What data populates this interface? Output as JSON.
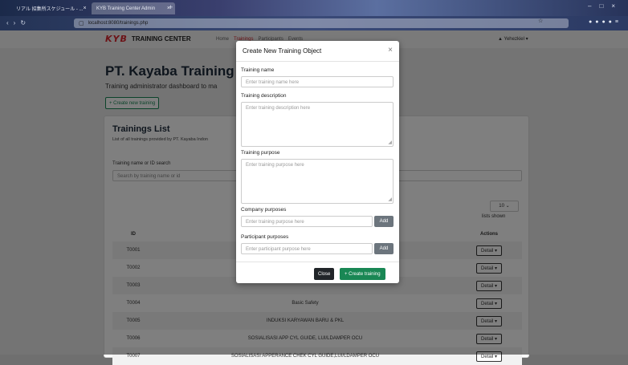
{
  "browser": {
    "tabs": [
      {
        "label": "リアル 招集所スケジュール - ..."
      },
      {
        "label": "KYB Training Center Admin"
      }
    ],
    "url": "localhost:8080/trainings.php"
  },
  "topnav": {
    "brand_logo": "KYB",
    "brand_text": "TRAINING CENTER",
    "links": [
      "Home",
      "Trainings",
      "Participants",
      "Events"
    ],
    "user": "Yehezkiel"
  },
  "page": {
    "heading": "PT. Kayaba Training",
    "subtitle": "Training administrator dashboard to ma",
    "create_button": "+ Create new training"
  },
  "card": {
    "title": "Trainings List",
    "subtitle": "List of all trainings provided by PT. Kayaba Indon",
    "search_label": "Training name or ID search",
    "search_placeholder": "Search by training name or id",
    "per_page": "10",
    "lists_shown": "lists shown",
    "columns": {
      "id": "ID",
      "name": "",
      "actions": "Actions"
    },
    "rows": [
      {
        "id": "T0001",
        "name": "",
        "action": "Detail"
      },
      {
        "id": "T0002",
        "name": "",
        "action": "Detail"
      },
      {
        "id": "T0003",
        "name": "",
        "action": "Detail"
      },
      {
        "id": "T0004",
        "name": "Basic Safety",
        "action": "Detail"
      },
      {
        "id": "T0005",
        "name": "INDUKSI KARYAWAN BARU & PKL",
        "action": "Detail"
      },
      {
        "id": "T0006",
        "name": "SOSIALISASI APP CYL GUIDE, LUI/LDAMPER OCU",
        "action": "Detail"
      },
      {
        "id": "T0007",
        "name": "SOSIALISASI APPERANCE CHEK CYL GUIDE,LUI/LDAMPER OCU",
        "action": "Detail"
      }
    ]
  },
  "modal": {
    "title": "Create New Training Object",
    "name_label": "Training name",
    "name_placeholder": "Enter training name here",
    "desc_label": "Training description",
    "desc_placeholder": "Enter training description here",
    "purpose_label": "Training purpose",
    "purpose_placeholder": "Enter training purpose here",
    "company_label": "Company purposes",
    "company_placeholder": "Enter training purpose here",
    "participant_label": "Participant purposes",
    "participant_placeholder": "Enter participant purpose here",
    "add_label": "Add",
    "close_label": "Close",
    "create_label": "+ Create training"
  },
  "colors": {
    "brand_red": "#d8262e",
    "success": "#198754",
    "dark": "#212529",
    "secondary": "#6c757d"
  }
}
